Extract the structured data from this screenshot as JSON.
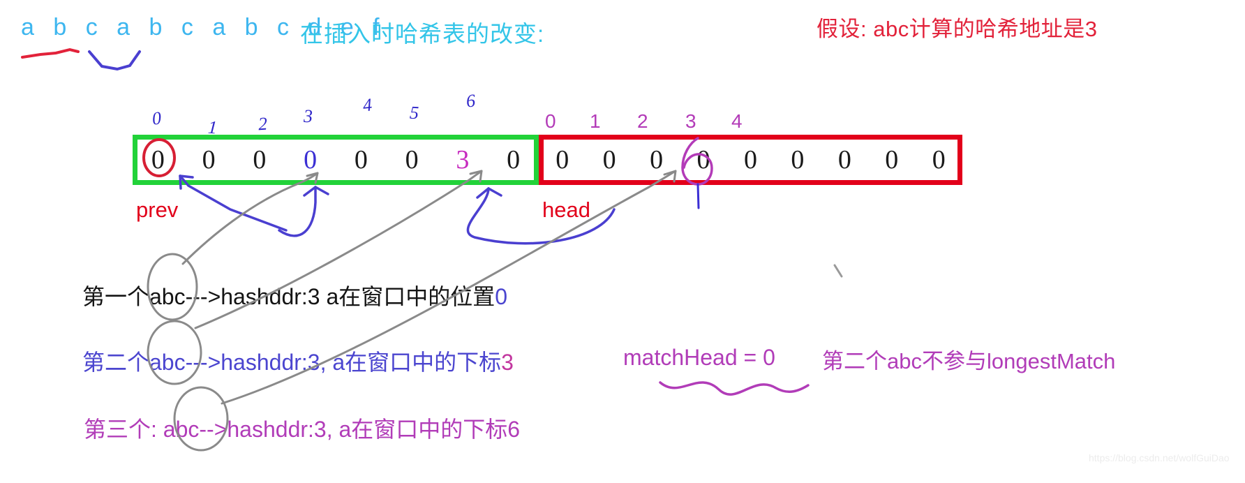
{
  "header": {
    "sequence": "a b c a b c a b c d e f",
    "insert_title": "在插入时哈希表的改变:",
    "assumption": "假设: abc计算的哈希地址是3"
  },
  "prev_array": {
    "label": "prev",
    "border_color": "#22d239",
    "indices": [
      "0",
      "1",
      "2",
      "3",
      "4",
      "5",
      "6"
    ],
    "cells": [
      {
        "value": "0",
        "color": "black",
        "circled": true
      },
      {
        "value": "0",
        "color": "black"
      },
      {
        "value": "0",
        "color": "black"
      },
      {
        "value": "0",
        "color": "blue"
      },
      {
        "value": "0",
        "color": "black"
      },
      {
        "value": "0",
        "color": "black"
      },
      {
        "value": "3",
        "color": "magenta"
      },
      {
        "value": "0",
        "color": "black"
      }
    ]
  },
  "head_array": {
    "label": "head",
    "border_color": "#e2001a",
    "indices": [
      "0",
      "1",
      "2",
      "3",
      "4"
    ],
    "cells": [
      {
        "value": "0",
        "color": "black"
      },
      {
        "value": "0",
        "color": "black"
      },
      {
        "value": "0",
        "color": "black"
      },
      {
        "value": "0",
        "color": "black",
        "handwritten_overlay": "6"
      },
      {
        "value": "0",
        "color": "black"
      },
      {
        "value": "0",
        "color": "black"
      },
      {
        "value": "0",
        "color": "black"
      },
      {
        "value": "0",
        "color": "black"
      },
      {
        "value": "0",
        "color": "black"
      }
    ]
  },
  "notes": {
    "line1_main": "第一个abc--->hashddr:3  a在窗口中的位置",
    "line1_tail": "0",
    "line2_main": "第二个abc--->hashddr:3, a在窗口中的下标",
    "line2_tail": "3",
    "line3_main": "第三个: abc-->hashddr:3, a在窗口中的下标6",
    "match_head": "matchHead = 0",
    "right_note": "第二个abc不参与longestMatch"
  },
  "watermark": "https://blog.csdn.net/wolfGuiDao",
  "colors": {
    "cyan": "#33c5e8",
    "red": "#e2001a",
    "green": "#22d239",
    "blue": "#3b2fd4",
    "magenta": "#b13cb8",
    "black": "#141414"
  }
}
